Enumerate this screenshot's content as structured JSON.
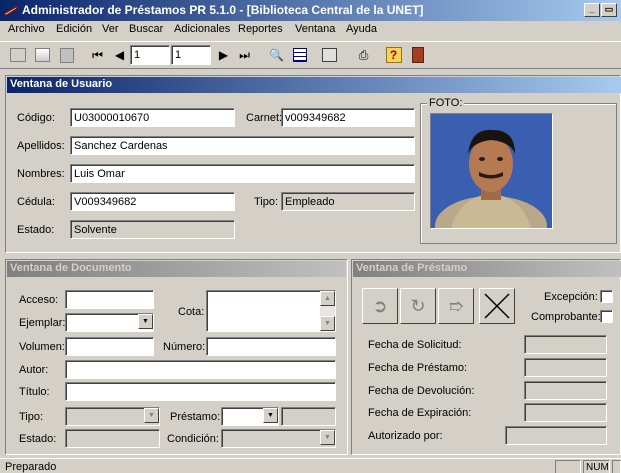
{
  "window": {
    "title": "Administrador de Préstamos PR 5.1.0 - [Biblioteca Central de la UNET]",
    "minimize_glyph": "_",
    "restore_glyph": "▭",
    "close_glyph": "×"
  },
  "menu": {
    "items": [
      "Archivo",
      "Edición",
      "Ver",
      "Buscar",
      "Adicionales",
      "Reportes",
      "Ventana",
      "Ayuda"
    ]
  },
  "toolbar": {
    "record_current": "1",
    "record_total": "1",
    "icons": [
      "new-icon",
      "copy-icon",
      "paste-icon",
      "first-record-icon",
      "prev-record-icon",
      "next-record-icon",
      "last-record-icon",
      "search-icon",
      "list-icon",
      "report-icon",
      "print-icon",
      "help-icon",
      "exit-icon"
    ]
  },
  "usuario": {
    "header": "Ventana de Usuario",
    "codigo_label": "Código:",
    "codigo_value": "U03000010670",
    "carnet_label": "Carnet:",
    "carnet_value": "v009349682",
    "apellidos_label": "Apellidos:",
    "apellidos_value": "Sanchez Cardenas",
    "nombres_label": "Nombres:",
    "nombres_value": "Luis Omar",
    "cedula_label": "Cédula:",
    "cedula_value": "V009349682",
    "tipo_label": "Tipo:",
    "tipo_value": "Empleado",
    "estado_label": "Estado:",
    "estado_value": "Solvente",
    "foto_label": "FOTO:"
  },
  "documento": {
    "header": "Ventana de Documento",
    "acceso_label": "Acceso:",
    "ejemplar_label": "Ejemplar:",
    "cota_label": "Cota:",
    "volumen_label": "Volumen:",
    "numero_label": "Número:",
    "autor_label": "Autor:",
    "titulo_label": "Título:",
    "tipo_label": "Tipo:",
    "prestamo_label": "Préstamo:",
    "estado_label": "Estado:",
    "condicion_label": "Condición:"
  },
  "prestamo": {
    "header": "Ventana de Préstamo",
    "excepcion_label": "Excepción:",
    "comprobante_label": "Comprobante:",
    "fecha_solicitud_label": "Fecha de Solicitud:",
    "fecha_prestamo_label": "Fecha de Préstamo:",
    "fecha_devolucion_label": "Fecha de Devolución:",
    "fecha_expiracion_label": "Fecha de Expiración:",
    "autorizado_label": "Autorizado por:"
  },
  "statusbar": {
    "status_text": "Preparado",
    "num_indicator": "NUM"
  },
  "colors": {
    "title_bar": "#0a246a",
    "active_panel_header": "#0a246a",
    "inactive_panel_header": "#808080",
    "face": "#d4d0c8"
  }
}
